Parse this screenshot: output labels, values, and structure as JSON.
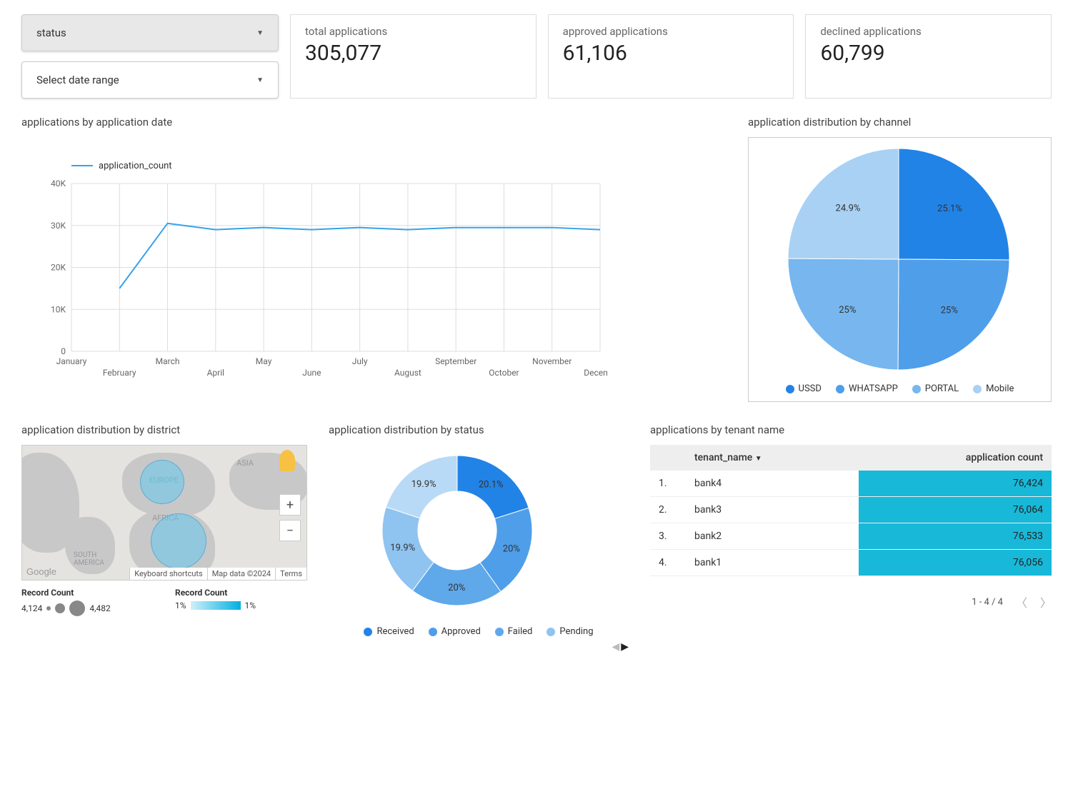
{
  "filters": {
    "status_label": "status",
    "date_label": "Select date range"
  },
  "kpi": {
    "total": {
      "label": "total applications",
      "value": "305,077"
    },
    "approved": {
      "label": "approved applications",
      "value": "61,106"
    },
    "declined": {
      "label": "declined applications",
      "value": "60,799"
    }
  },
  "lineChart": {
    "title": "applications by application date",
    "series_label": "application_count"
  },
  "pieChart": {
    "title": "application distribution by channel"
  },
  "mapChart": {
    "title": "application distribution by district",
    "record_count_label": "Record Count",
    "size_min": "4,124",
    "size_max": "4,482",
    "color_min": "1%",
    "color_max": "1%",
    "footer": {
      "shortcuts": "Keyboard shortcuts",
      "mapdata": "Map data ©2024",
      "terms": "Terms"
    }
  },
  "donutChart": {
    "title": "application distribution by status"
  },
  "tenantTable": {
    "title": "applications by tenant name",
    "col_tenant": "tenant_name",
    "col_count": "application count",
    "rows": [
      {
        "idx": "1.",
        "name": "bank4",
        "count": "76,424"
      },
      {
        "idx": "2.",
        "name": "bank3",
        "count": "76,064"
      },
      {
        "idx": "3.",
        "name": "bank2",
        "count": "76,533"
      },
      {
        "idx": "4.",
        "name": "bank1",
        "count": "76,056"
      }
    ],
    "pager": "1 - 4 / 4"
  },
  "chart_data": [
    {
      "type": "line",
      "title": "applications by application date",
      "x": [
        "January",
        "February",
        "March",
        "April",
        "May",
        "June",
        "July",
        "August",
        "September",
        "October",
        "November",
        "December"
      ],
      "series": [
        {
          "name": "application_count",
          "values": [
            null,
            15000,
            30500,
            29000,
            29500,
            29000,
            29500,
            29000,
            29500,
            29500,
            29500,
            29000
          ]
        }
      ],
      "ylabel": "",
      "ylim": [
        0,
        40000
      ],
      "grid": true
    },
    {
      "type": "pie",
      "title": "application distribution by channel",
      "categories": [
        "USSD",
        "WHATSAPP",
        "PORTAL",
        "Mobile"
      ],
      "values": [
        25.1,
        25,
        25,
        24.9
      ],
      "colors": [
        "#2283e6",
        "#4f9ee9",
        "#77b6ee",
        "#a8d1f4"
      ]
    },
    {
      "type": "pie",
      "title": "application distribution by status",
      "subtype": "donut",
      "categories": [
        "Received",
        "Approved",
        "Failed",
        "Pending"
      ],
      "values": [
        20.1,
        20,
        20,
        19.9,
        19.9
      ],
      "colors": [
        "#2283e6",
        "#4f9ee9",
        "#5fa8ea",
        "#8fc3f0",
        "#b9daf6"
      ]
    },
    {
      "type": "table",
      "title": "applications by tenant name",
      "columns": [
        "tenant_name",
        "application count"
      ],
      "rows": [
        [
          "bank4",
          76424
        ],
        [
          "bank3",
          76064
        ],
        [
          "bank2",
          76533
        ],
        [
          "bank1",
          76056
        ]
      ]
    }
  ]
}
